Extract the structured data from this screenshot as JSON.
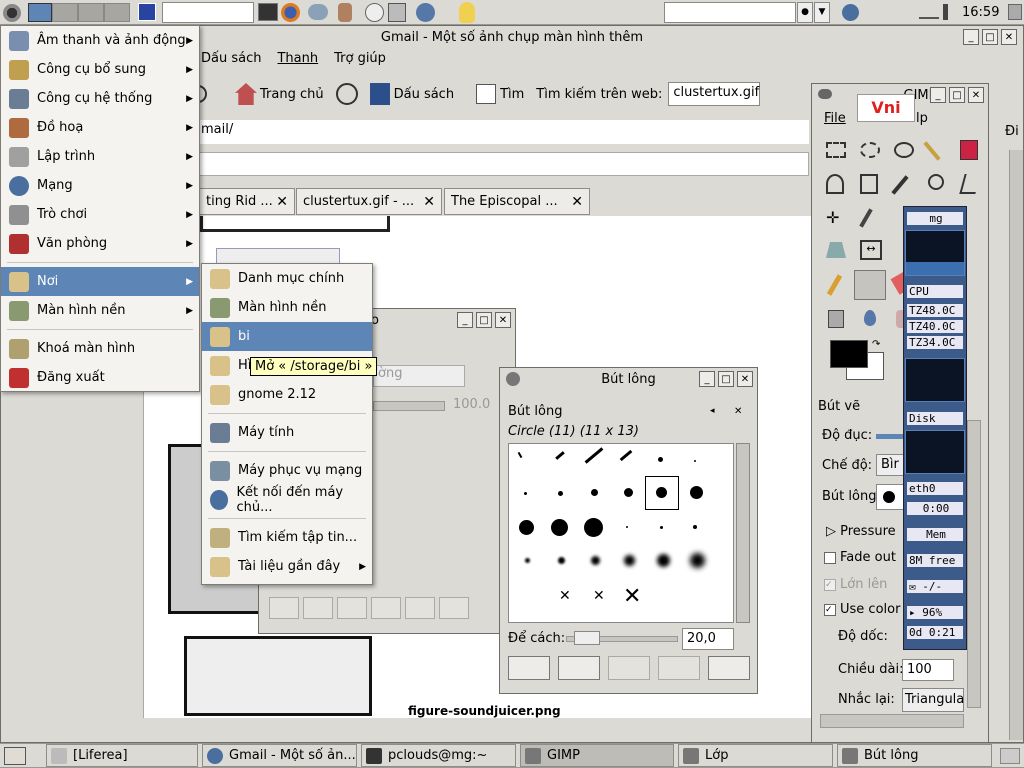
{
  "top_panel": {
    "clock": "16:59"
  },
  "browser": {
    "title": "Gmail - Một số ảnh chụp màn hình thêm",
    "menubar": [
      "Dấu sách",
      "Thanh",
      "Trợ giúp"
    ],
    "toolbar": {
      "home": "Trang chủ",
      "bookmarks": "Dấu sách",
      "find": "Tìm",
      "web_search_label": "Tìm kiếm trên web:",
      "web_search_value": "clustertux.gif"
    },
    "url": "mail/",
    "go_label": "Đi",
    "tabs": [
      {
        "label": "ting Rid ..."
      },
      {
        "label": "clustertux.gif - ..."
      },
      {
        "label": "The Episcopal ..."
      }
    ],
    "figure_caption": "figure-soundjuicer.png"
  },
  "app_menu": {
    "items": [
      {
        "label": "Âm thanh và ảnh động",
        "submenu": true
      },
      {
        "label": "Công cụ bổ sung",
        "submenu": true
      },
      {
        "label": "Công cụ hệ thống",
        "submenu": true
      },
      {
        "label": "Đồ hoạ",
        "submenu": true
      },
      {
        "label": "Lập trình",
        "submenu": true
      },
      {
        "label": "Mạng",
        "submenu": true
      },
      {
        "label": "Trò chơi",
        "submenu": true
      },
      {
        "label": "Văn phòng",
        "submenu": true
      },
      {
        "label": "Nơi",
        "submenu": true,
        "selected": true
      },
      {
        "label": "Màn hình nền",
        "submenu": true
      },
      {
        "label": "Khoá màn hình",
        "submenu": false
      },
      {
        "label": "Đăng xuất",
        "submenu": false
      }
    ]
  },
  "places_menu": {
    "items": [
      {
        "label": "Danh mục chính"
      },
      {
        "label": "Màn hình nền"
      },
      {
        "label": "bi",
        "selected": true
      },
      {
        "label": "Hì"
      },
      {
        "label": "gnome 2.12"
      },
      {
        "label": "Máy tính"
      },
      {
        "label": "Máy phục vụ mạng"
      },
      {
        "label": "Kết nối đến máy chủ..."
      },
      {
        "label": "Tìm kiếm tập tin..."
      },
      {
        "label": "Tài liệu gần đây"
      }
    ],
    "tooltip": "Mở « /storage/bi »"
  },
  "layers_dialog": {
    "title_fragment": "o",
    "mode_fragment": "ờng",
    "opacity_value": "100.0"
  },
  "brush_dialog": {
    "title": "Bút lông",
    "panel_label": "Bút lông",
    "brush_name": "Circle (11) (11 x 13)",
    "spacing_label": "Để cách:",
    "spacing_value": "20,0"
  },
  "gimp_toolbox": {
    "title_fragment": "GIMP",
    "menu_file": "File",
    "menu_help_fragment": "lp",
    "ime_badge": "Vni",
    "tool_options_title": "Bút vẽ",
    "opacity_label": "Độ đục:",
    "mode_label": "Chế độ:",
    "mode_value": "Bìr",
    "brush_label": "Bút lông:",
    "pressure_label": "Pressure",
    "fade_label": "Fade out",
    "incremental_label": "Lớn lên",
    "use_color_label": "Use color",
    "gradient_label": "Độ dốc:",
    "length_label": "Chiều dài:",
    "length_value": "100",
    "repeat_label": "Nhắc lại:",
    "repeat_value": "Triangular"
  },
  "monitors": {
    "host": "mg",
    "cpu": "CPU",
    "tz1": "TZ48.0C",
    "tz2": "TZ40.0C",
    "tz3": "TZ34.0C",
    "disk": "Disk",
    "net": "eth0",
    "net_time": "0:00",
    "mem": "Mem",
    "mem_free": "8M free",
    "mail": "-/-",
    "battery": "96%",
    "uptime": "0d 0:21"
  },
  "taskbar": {
    "items": [
      {
        "label": "[Liferea]"
      },
      {
        "label": "Gmail - Một số ản..."
      },
      {
        "label": "pclouds@mg:~"
      },
      {
        "label": "GIMP",
        "active": true
      },
      {
        "label": "Lớp"
      },
      {
        "label": "Bút lông"
      }
    ]
  },
  "colors": {
    "selection": "#5d85b5",
    "panel": "#dcdad5",
    "monitor_bg": "#0b1424"
  }
}
